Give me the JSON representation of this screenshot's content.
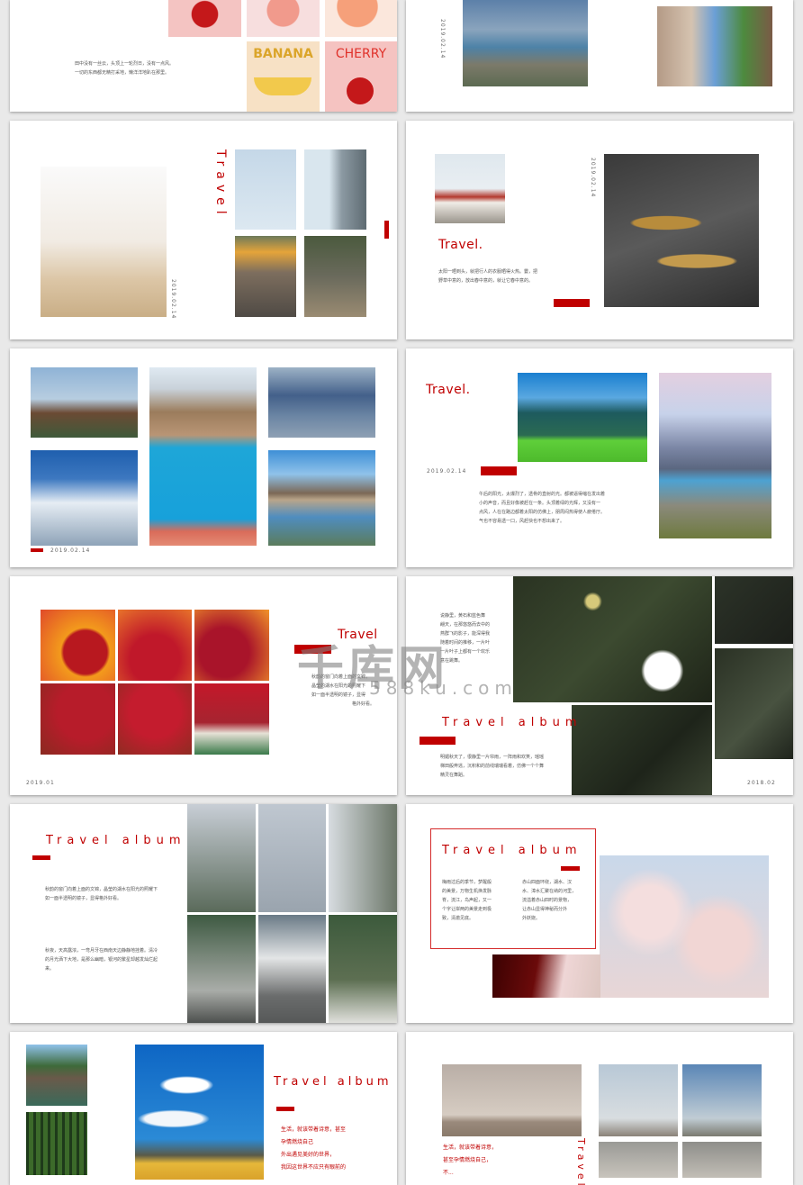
{
  "accent_color": "#c00000",
  "watermark": {
    "logo": "千库网",
    "url": "588ku.com"
  },
  "slides": {
    "s0l": {
      "text": [
        "田中没有一丝云，头顶上一轮烈日，没有一点风。",
        "一切的东西都无精打采地，懒洋洋地趴在那里。"
      ],
      "fruit_labels": [
        "BANANA",
        "CHERRY"
      ]
    },
    "s0r": {
      "date": "2019.02.14"
    },
    "s1l": {
      "title": "Travel",
      "date": "2019.02.14"
    },
    "s1r": {
      "title": "Travel.",
      "date": "2019.02.14",
      "text": [
        "太阳一晒到头，就把行人的衣服晒得火热。霎，把",
        "野草中意的，放出春中意的，就让它春中意的。"
      ]
    },
    "s2l": {
      "date": "2019.02.14"
    },
    "s2r": {
      "title": "Travel.",
      "date": "2019.02.14",
      "text": [
        "午后的阳光，太爆烈了，透骨的直射的光。都被逼得缩在发出着",
        "小的声音，而且好像被赶在一条。头顶着绿的光辉，又没有一",
        "点风，人在在路边都着太阳的仿佛上，朋周闷热得使人疲倦厅。",
        "气也不容易透一口，风赶快也不想出来了。"
      ]
    },
    "s3l": {
      "title": "Travel",
      "date": "2019.01",
      "text": [
        "秋韵的窗门向着上面的文锦，",
        "晶莹的湖水在阳光的照耀下",
        "如一面半透明的镜子，显得",
        "格外好看。"
      ]
    },
    "s3r": {
      "title": "Travel album",
      "date": "2018.02",
      "text_top": [
        "说静里，黄石和蓝色舞",
        "翩天，在那悠悠而去中的",
        "燕群飞的影子，能深得我",
        "随着时间的推移，一片叶",
        "一片叶子上都有一个欢乐",
        "意在跳舞。"
      ],
      "text_bottom": [
        "明媚秋天了，很静里一片帘雨，一阵雨和欢笑，瑶瑶",
        "梯田般奔逃，沉积和的前线瑞瑞看着，仿佛一个个舞",
        "精灵在舞蹈。"
      ]
    },
    "s4l": {
      "title": "Travel album",
      "text_1": [
        "秋韵的窗门向着上面的文锦，晶莹的湖水在阳光的照耀下",
        "如一面半透明的镜子，显得格外好看。"
      ],
      "text_2": [
        "秋夜，天高露浓，一弯月牙在西南天边静静地挂着。清冷",
        "的月光洒下大地，是那么幽暗，银河的繁星却越发灿烂起",
        "来。"
      ]
    },
    "s4r": {
      "title": "Travel album",
      "col_1": [
        "梅雨过后的季节，梦醒般",
        "的美景，万物生机焕发脉",
        "脊，流江，鸟声起，又一",
        "个字让岸两的美景走到极",
        "致，清澈见底。"
      ],
      "col_2": [
        "赤山四面环绕，湖水、汉",
        "水、漳水汇聚在纳的河里，",
        "流溢着赤山四时的景物，",
        "让赤山显得神秘而分外",
        "外妖娆。"
      ]
    },
    "s5l": {
      "title": "Travel album",
      "text": [
        "生活，就该带着诗意，甚至",
        "孕情燃烧自己",
        "外出遇见美好的世界，",
        "我因这世界不应只有眼前的"
      ]
    },
    "s5r": {
      "title": "Travel",
      "text": [
        "生活，就该带着诗意，",
        "甚至孕情燃烧自己，",
        "不..."
      ]
    }
  }
}
